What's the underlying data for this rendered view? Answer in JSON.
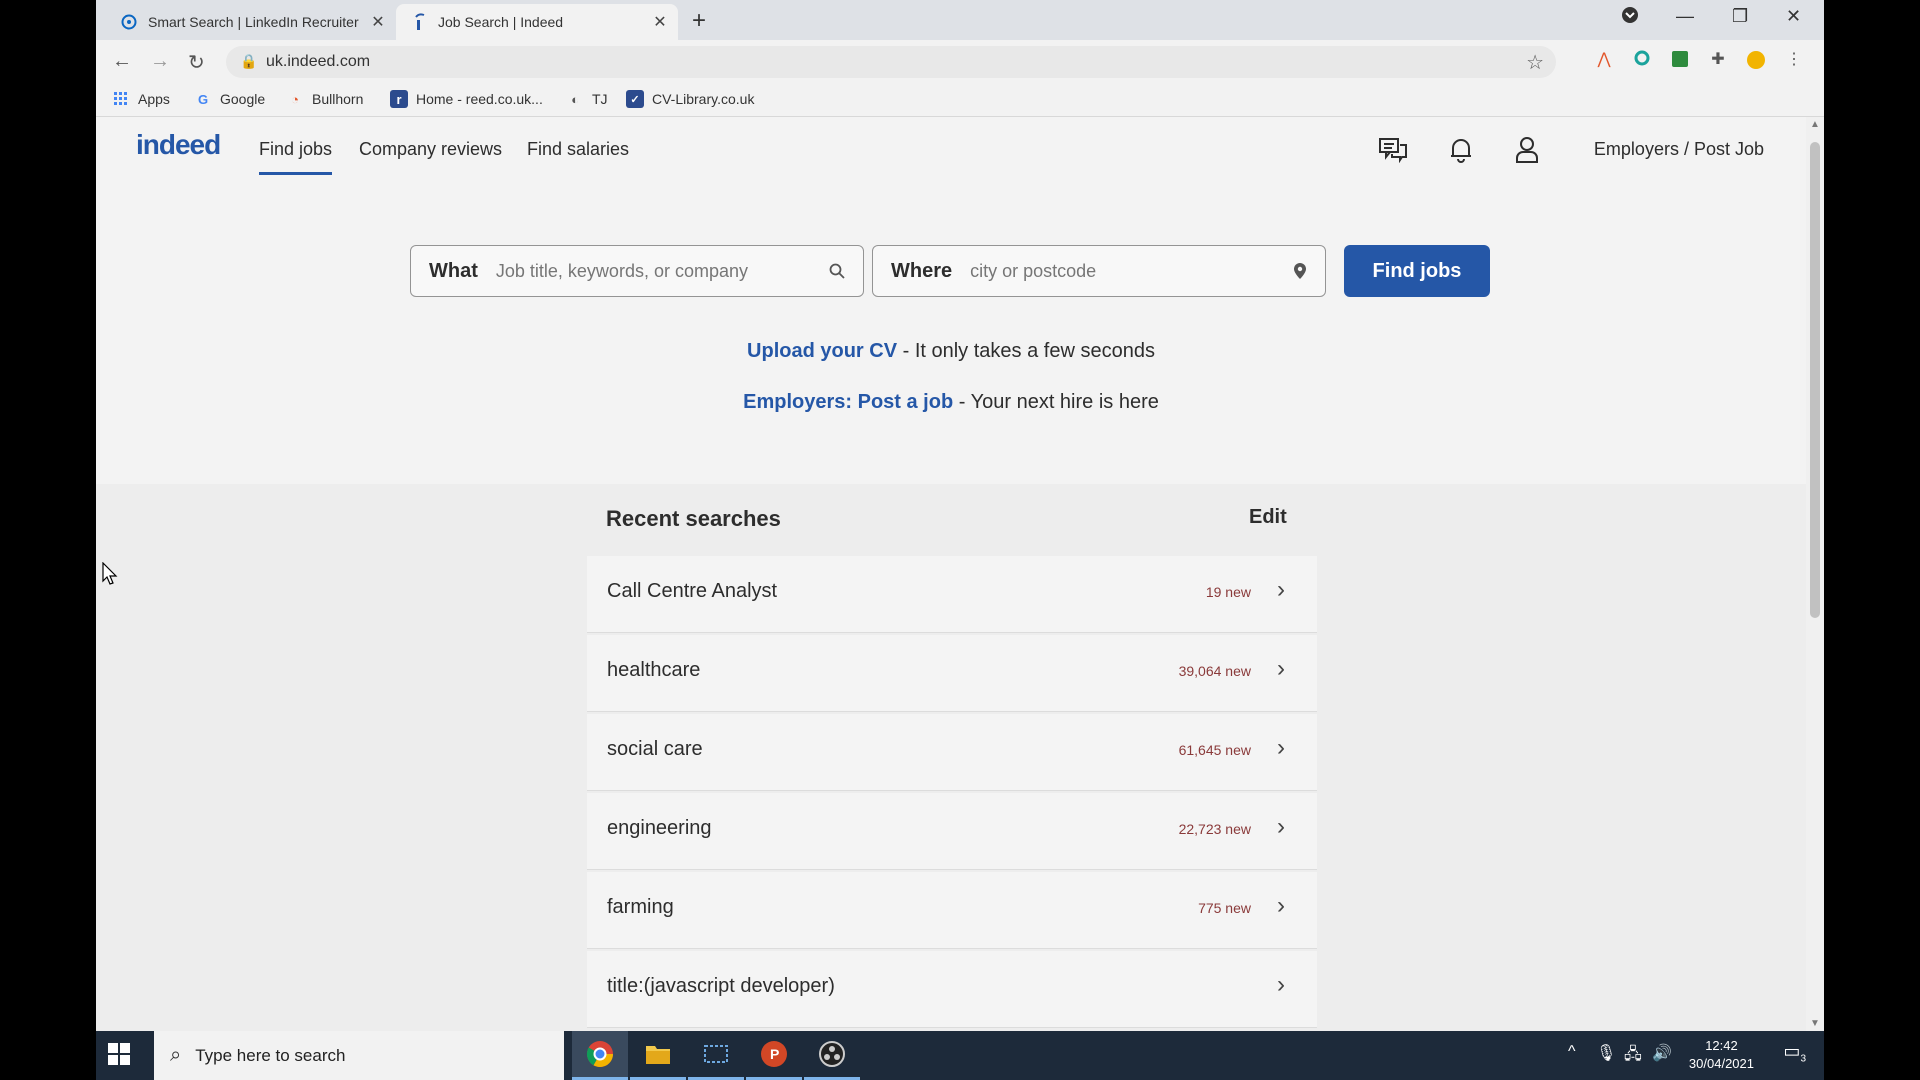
{
  "browser": {
    "tabs": [
      {
        "title": "Smart Search | LinkedIn Recruiter",
        "icon": "linkedin-recruiter-icon"
      },
      {
        "title": "Job Search | Indeed",
        "icon": "indeed-icon"
      }
    ],
    "url": "uk.indeed.com",
    "bookmarks": [
      "Apps",
      "Google",
      "Bullhorn",
      "Home - reed.co.uk...",
      "TJ",
      "CV-Library.co.uk"
    ]
  },
  "site": {
    "logo": "indeed",
    "nav": [
      "Find jobs",
      "Company reviews",
      "Find salaries"
    ],
    "employers_link": "Employers / Post Job"
  },
  "search": {
    "what_label": "What",
    "what_placeholder": "Job title, keywords, or company",
    "where_label": "Where",
    "where_placeholder": "city or postcode",
    "button": "Find jobs"
  },
  "promo": {
    "cv_link": "Upload your CV",
    "cv_text": " - It only takes a few seconds",
    "employer_link": "Employers: Post a job",
    "employer_text": " - Your next hire is here"
  },
  "recent": {
    "title": "Recent searches",
    "edit": "Edit",
    "items": [
      {
        "query": "Call Centre Analyst",
        "new": "19 new"
      },
      {
        "query": "healthcare",
        "new": "39,064 new"
      },
      {
        "query": "social care",
        "new": "61,645 new"
      },
      {
        "query": "engineering",
        "new": "22,723 new"
      },
      {
        "query": "farming",
        "new": "775 new"
      },
      {
        "query": "title:(javascript developer)",
        "new": ""
      }
    ]
  },
  "taskbar": {
    "search_placeholder": "Type here to search",
    "time": "12:42",
    "date": "30/04/2021",
    "notifications": "3"
  },
  "colors": {
    "brand": "#2557a7",
    "new_count": "#8a3a3a"
  }
}
